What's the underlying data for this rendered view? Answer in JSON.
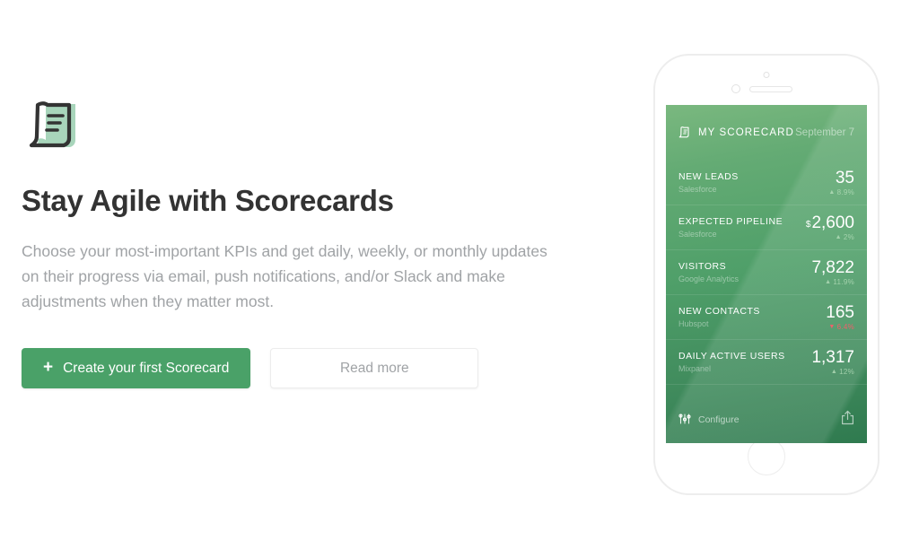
{
  "hero": {
    "icon_name": "scorecard-document-icon",
    "headline": "Stay Agile with Scorecards",
    "body": "Choose your most-important KPIs and get daily, weekly, or monthly updates on their progress via email, push notifications, and/or Slack and make adjustments when they matter most.",
    "primary_button": {
      "label": "Create your first Scorecard",
      "icon": "plus-icon",
      "glyph": "+",
      "color": "#4aa168"
    },
    "secondary_button": {
      "label": "Read more"
    }
  },
  "phone": {
    "device": "smartphone-mockup",
    "frame_color": "#ededed"
  },
  "scorecard": {
    "header": {
      "icon": "scorecard-document-icon",
      "title": "MY SCORECARD",
      "date": "September 7"
    },
    "colors": {
      "gradient_top": "#7ab87f",
      "gradient_bottom": "#2f7a4f",
      "positive": "#bae0be",
      "negative": "#ef5f6b"
    },
    "rows": [
      {
        "metric": "NEW LEADS",
        "source": "Salesforce",
        "currency": "",
        "value": "35",
        "delta": "8.9%",
        "arrow": "▲",
        "direction": "up"
      },
      {
        "metric": "EXPECTED PIPELINE",
        "source": "Salesforce",
        "currency": "$",
        "value": "2,600",
        "delta": "2%",
        "arrow": "▲",
        "direction": "up"
      },
      {
        "metric": "VISITORS",
        "source": "Google Analytics",
        "currency": "",
        "value": "7,822",
        "delta": "11.9%",
        "arrow": "▲",
        "direction": "up"
      },
      {
        "metric": "NEW CONTACTS",
        "source": "Hubspot",
        "currency": "",
        "value": "165",
        "delta": "6.4%",
        "arrow": "▼",
        "direction": "down"
      },
      {
        "metric": "DAILY ACTIVE USERS",
        "source": "Mixpanel",
        "currency": "",
        "value": "1,317",
        "delta": "12%",
        "arrow": "▲",
        "direction": "up"
      }
    ],
    "footer": {
      "configure_label": "Configure",
      "configure_icon": "sliders-icon",
      "share_icon": "share-icon"
    }
  }
}
